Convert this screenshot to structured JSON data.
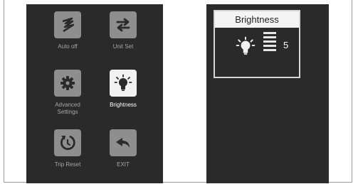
{
  "menu": {
    "items": [
      {
        "label": "Auto off",
        "icon": "auto-off-icon"
      },
      {
        "label": "Unit Set",
        "icon": "unit-set-icon"
      },
      {
        "label": "Advanced Settings",
        "line1": "Advanced",
        "line2": "Settings",
        "icon": "gear-icon"
      },
      {
        "label": "Brightness",
        "icon": "bulb-icon",
        "selected": true
      },
      {
        "label": "Trip Reset",
        "icon": "reset-icon"
      },
      {
        "label": "EXIT",
        "icon": "back-arrow-icon"
      }
    ]
  },
  "brightness": {
    "title": "Brightness",
    "value": "5",
    "icon": "bulb-icon"
  },
  "colors": {
    "panel_bg": "#2a2a2a",
    "icon_bg": "#8e8e8e",
    "selected_icon_bg": "#f2f2f2"
  }
}
